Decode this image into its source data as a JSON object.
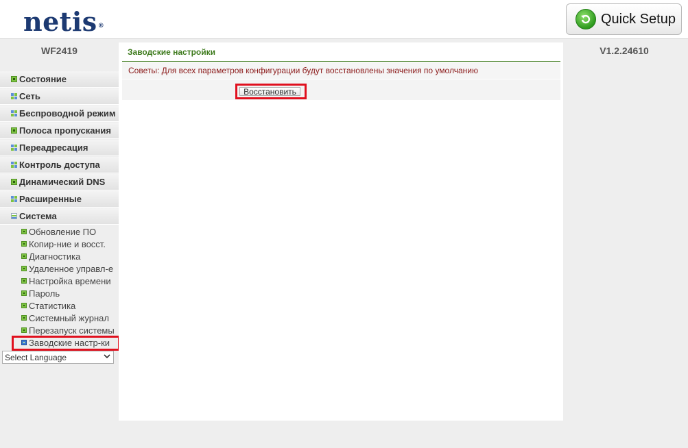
{
  "header": {
    "logo_text": "netis",
    "logo_mark": "®",
    "quick_setup_label": "Quick Setup",
    "quick_setup_icon": "refresh-arrow-icon"
  },
  "sidebar": {
    "model": "WF2419",
    "items": [
      {
        "label": "Состояние",
        "icon": "green-square-icon"
      },
      {
        "label": "Сеть",
        "icon": "grid-icon"
      },
      {
        "label": "Беспроводной режим",
        "icon": "grid-icon"
      },
      {
        "label": "Полоса пропускания",
        "icon": "green-square-icon"
      },
      {
        "label": "Переадресация",
        "icon": "grid-icon"
      },
      {
        "label": "Контроль доступа",
        "icon": "grid-icon"
      },
      {
        "label": "Динамический DNS",
        "icon": "green-square-icon"
      },
      {
        "label": "Расширенные",
        "icon": "grid-icon"
      },
      {
        "label": "Система",
        "icon": "expanded-minus-icon"
      }
    ],
    "sub_items": [
      {
        "label": "Обновление ПО"
      },
      {
        "label": "Копир-ние и восст."
      },
      {
        "label": "Диагностика"
      },
      {
        "label": "Удаленное управл-е"
      },
      {
        "label": "Настройка времени"
      },
      {
        "label": "Пароль"
      },
      {
        "label": "Статистика"
      },
      {
        "label": "Системный журнал"
      },
      {
        "label": "Перезапуск системы"
      },
      {
        "label": "Заводские настр-ки",
        "active": true
      }
    ],
    "language_select": "Select Language"
  },
  "main": {
    "title": "Заводские настройки",
    "tip": "Советы: Для всех параметров конфигурации будут восстановлены значения по умолчанию",
    "restore_button": "Восстановить"
  },
  "version": "V1.2.24610",
  "colors": {
    "accent_green": "#3d7a1c",
    "tip_text": "#8b1a1a",
    "highlight_red": "#e0101e",
    "logo_blue": "#1d3a72"
  }
}
